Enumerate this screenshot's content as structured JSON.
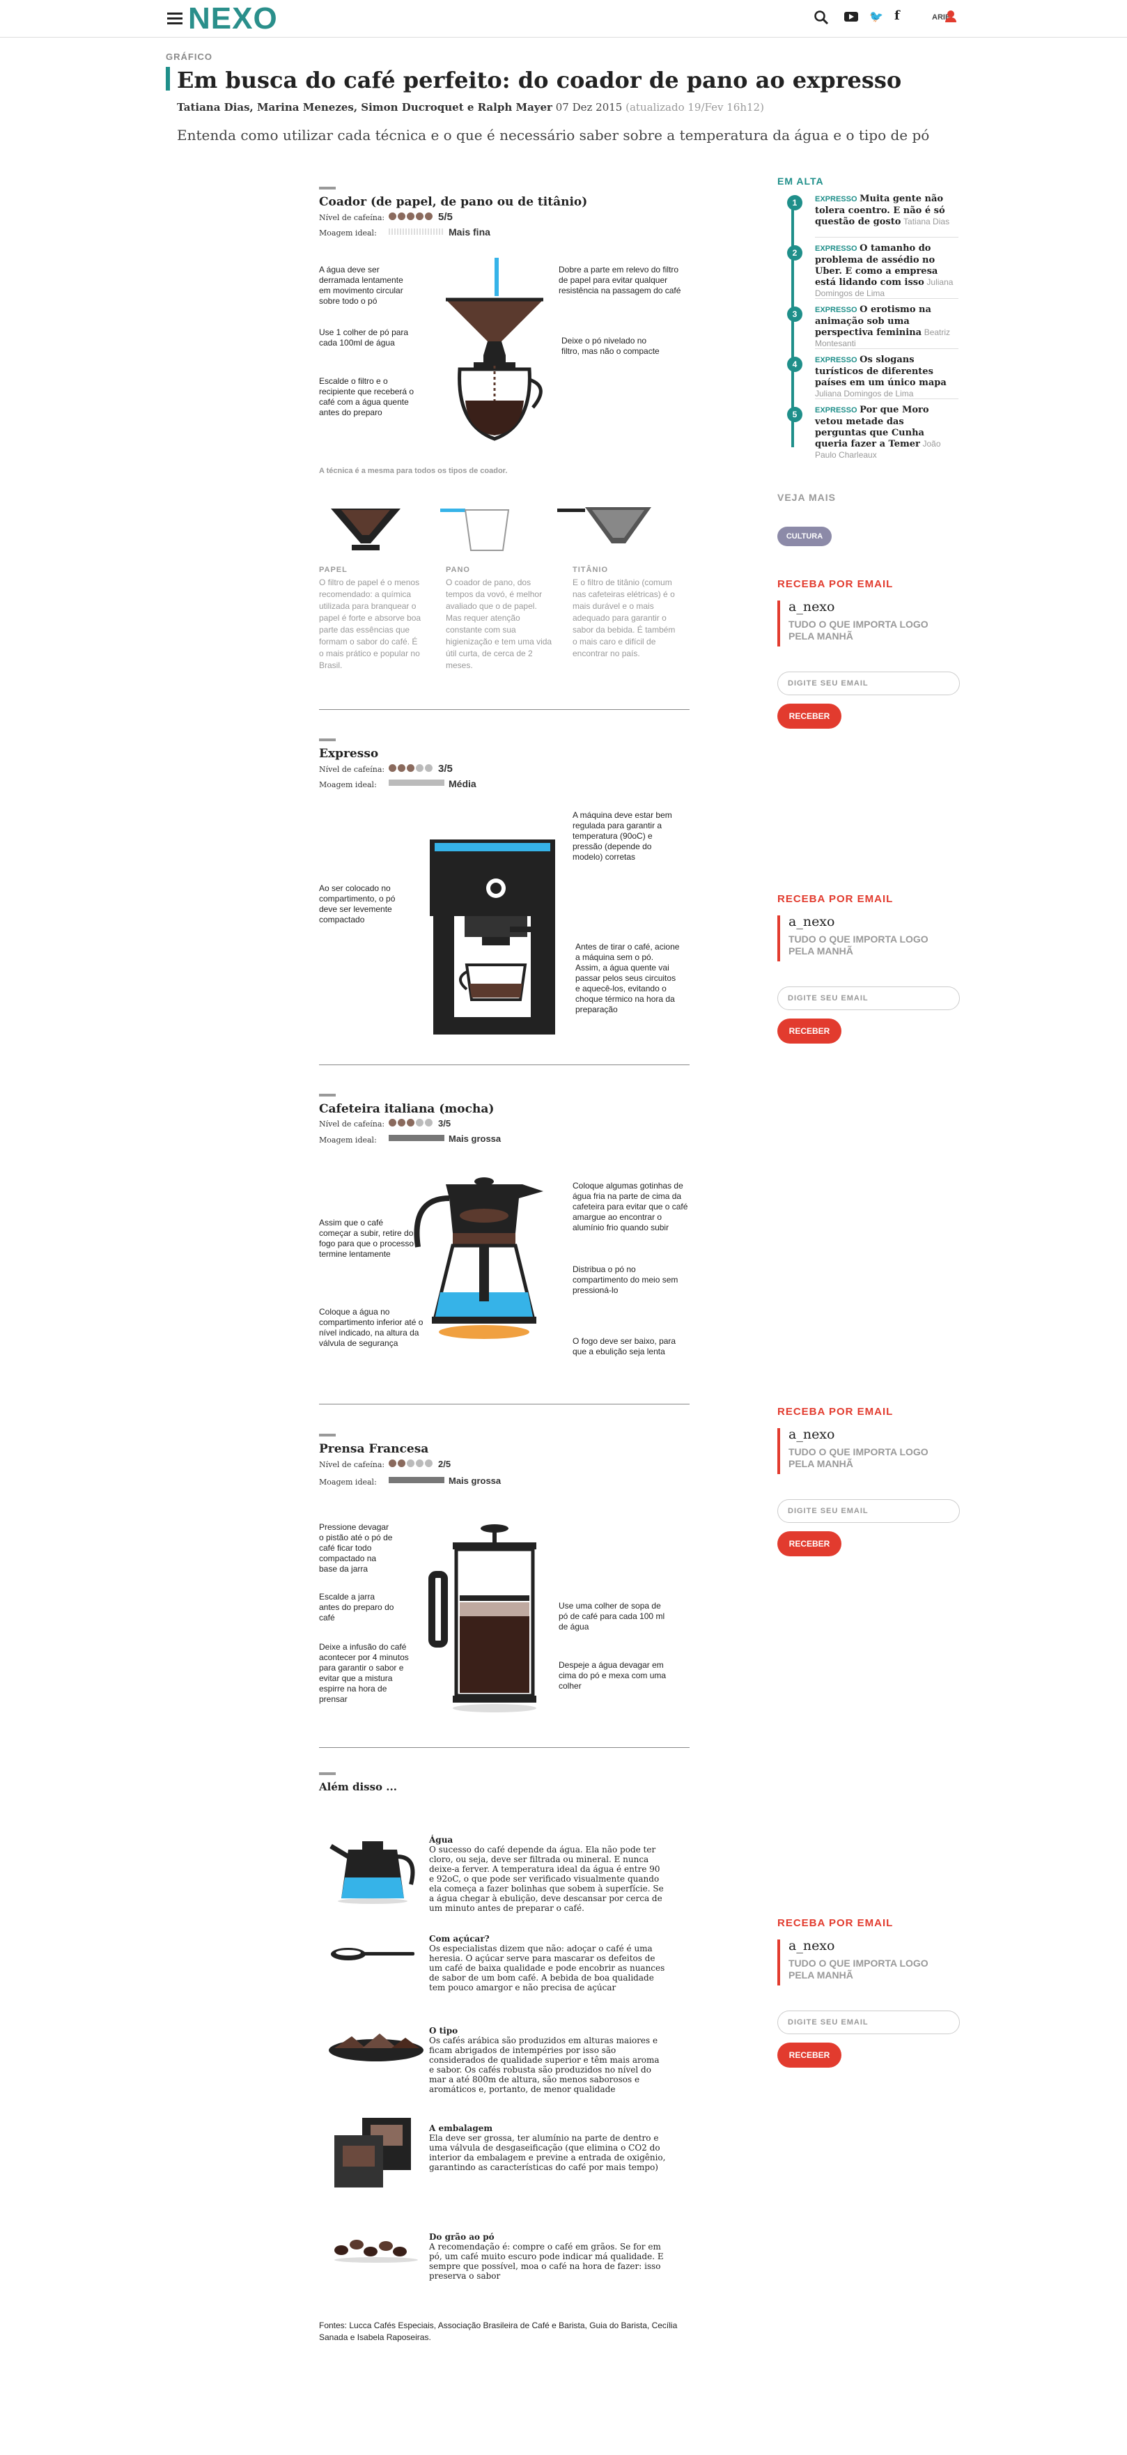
{
  "header": {
    "logo": "NEXO",
    "user": "ARIEL"
  },
  "article": {
    "kicker": "GRÁFICO",
    "title": "Em busca do café perfeito: do coador de pano ao expresso",
    "authors": "Tatiana Dias, Marina Menezes, Simon Ducroquet e Ralph Mayer",
    "date": "07 Dez 2015",
    "updated": "(atualizado 19/Fev 16h12)",
    "subtitle": "Entenda como utilizar cada técnica e o que é necessário saber sobre a temperatura da água e o tipo de pó"
  },
  "labels": {
    "caffeine": "Nível de cafeína:",
    "grind": "Moagem ideal:"
  },
  "coador": {
    "title": "Coador (de papel, de pano ou de titânio)",
    "caffeine": "5/5",
    "grind": "Mais fina",
    "notes": [
      "A água deve ser derramada lentamente em movimento circular sobre todo o pó",
      "Use 1 colher de pó para cada 100ml de água",
      "Escalde o filtro e o recipiente que receberá o café com a água quente antes do preparo",
      "Dobre a parte em relevo do filtro de papel para evitar qualquer resistência na passagem do café",
      "Deixe o pó nivelado no filtro, mas não o compacte"
    ],
    "same": "A técnica é a mesma para todos os tipos de coador.",
    "types": [
      {
        "name": "PAPEL",
        "text": "O filtro de papel é o menos recomendado: a química utilizada para branquear o papel é forte e absorve boa parte das essências que formam o sabor do café. É o mais prático e popular no Brasil."
      },
      {
        "name": "PANO",
        "text": "O coador de pano, dos tempos da vovó, é melhor avaliado que o de papel. Mas requer atenção constante com sua higienização e tem uma vida útil curta, de cerca de 2 meses."
      },
      {
        "name": "TITÂNIO",
        "text": "E o filtro de titânio (comum nas cafeteiras elétricas) é o mais durável e o mais adequado para garantir o sabor da bebida. É também o mais caro e difícil de encontrar no país."
      }
    ]
  },
  "expresso": {
    "title": "Expresso",
    "caffeine": "3/5",
    "grind": "Média",
    "notes": [
      "A máquina deve estar bem regulada para garantir a temperatura (90oC) e pressão (depende do modelo) corretas",
      "Ao ser colocado no compartimento, o pó deve ser levemente compactado",
      "Antes de tirar o café, acione a máquina sem o pó. Assim, a água quente vai passar pelos seus circuitos e aquecê-los, evitando o choque térmico na hora da preparação"
    ]
  },
  "mocha": {
    "title": "Cafeteira italiana (mocha)",
    "caffeine": "3/5",
    "grind": "Mais grossa",
    "notes": [
      "Assim que o café começar a subir, retire do fogo para que o processo termine lentamente",
      "Coloque a água no compartimento inferior até o nível indicado, na altura da válvula de segurança",
      "Coloque algumas gotinhas de água fria na parte de cima da cafeteira para evitar que o café amargue ao encontrar o alumínio frio quando subir",
      "Distribua o pó no compartimento do meio sem pressioná-lo",
      "O fogo deve ser baixo, para que a ebulição seja lenta"
    ]
  },
  "prensa": {
    "title": "Prensa Francesa",
    "caffeine": "2/5",
    "grind": "Mais grossa",
    "notes": [
      "Pressione devagar o pistão até o pó de café ficar todo compactado na base da jarra",
      "Escalde a jarra antes do preparo do café",
      "Deixe a infusão do café acontecer por 4 minutos para garantir o sabor e evitar que a mistura espirre na hora de prensar",
      "Use uma colher de sopa de pó de café para cada 100 ml de água",
      "Despeje a água devagar em cima do pó e mexa com uma colher"
    ]
  },
  "extras": {
    "title": "Além disso ...",
    "items": [
      {
        "title": "Água",
        "text": "O sucesso do café depende da água. Ela não pode ter cloro, ou seja, deve ser filtrada ou mineral. E nunca deixe-a ferver. A temperatura ideal da água é entre 90 e 92oC, o que pode ser verificado visualmente quando ela começa a fazer bolinhas que sobem à superfície. Se a água chegar à ebulição, deve descansar por cerca de um minuto antes de preparar o café."
      },
      {
        "title": "Com açúcar?",
        "text": "Os especialistas dizem que não: adoçar o café é uma heresia. O açúcar serve para mascarar os defeitos de um café de baixa qualidade e pode encobrir as nuances de sabor de um bom café. A bebida de boa qualidade tem pouco amargor e não precisa de açúcar"
      },
      {
        "title": "O tipo",
        "text": "Os cafés arábica são produzidos em alturas maiores e ficam abrigados de intempéries por isso são considerados de qualidade superior e têm mais aroma e sabor. Os cafés robusta são produzidos no nível do mar a até 800m de altura, são menos saborosos e aromáticos e, portanto, de menor qualidade"
      },
      {
        "title": "A embalagem",
        "text": "Ela deve ser grossa, ter alumínio na parte de dentro e uma válvula de desgaseificação (que elimina o CO2 do interior da embalagem e previne a entrada de oxigênio, garantindo as características do café por mais tempo)"
      },
      {
        "title": "Do grão ao pó",
        "text": "A recomendação é: compre o café em grãos. Se for em pó, um café muito escuro pode indicar má qualidade. E sempre que possível, moa o café na hora de fazer: isso preserva o sabor"
      }
    ]
  },
  "sources": "Fontes: Lucca Cafés Especiais, Associação Brasileira de Café e Barista, Guia do Barista, Cecília Sanada e Isabela Raposeiras.",
  "sidebar": {
    "trending_title": "EM ALTA",
    "trending": [
      {
        "n": "1",
        "kicker": "EXPRESSO",
        "title": "Muita gente não tolera coentro. E não é só questão de gosto",
        "author": "Tatiana Dias"
      },
      {
        "n": "2",
        "kicker": "EXPRESSO",
        "title": "O tamanho do problema de assédio no Uber. E como a empresa está lidando com isso",
        "author": "Juliana Domingos de Lima"
      },
      {
        "n": "3",
        "kicker": "EXPRESSO",
        "title": "O erotismo na animação sob uma perspectiva feminina",
        "author": "Beatriz Montesanti"
      },
      {
        "n": "4",
        "kicker": "EXPRESSO",
        "title": "Os slogans turísticos de diferentes países em um único mapa",
        "author": "Juliana Domingos de Lima"
      },
      {
        "n": "5",
        "kicker": "EXPRESSO",
        "title": "Por que Moro vetou metade das perguntas que Cunha queria fazer a Temer",
        "author": "João Paulo Charleaux"
      }
    ],
    "veja_mais": "VEJA MAIS",
    "tag": "CULTURA",
    "newsletter": {
      "heading": "RECEBA POR EMAIL",
      "logo": "a_nexo",
      "tagline": "TUDO O QUE IMPORTA LOGO PELA MANHÃ",
      "placeholder": "DIGITE SEU EMAIL",
      "button": "RECEBER"
    }
  },
  "colors": {
    "accent": "#1f8f8a",
    "red": "#e23b2e",
    "coffee": "#5b3a2e",
    "water": "#36b3e8"
  }
}
